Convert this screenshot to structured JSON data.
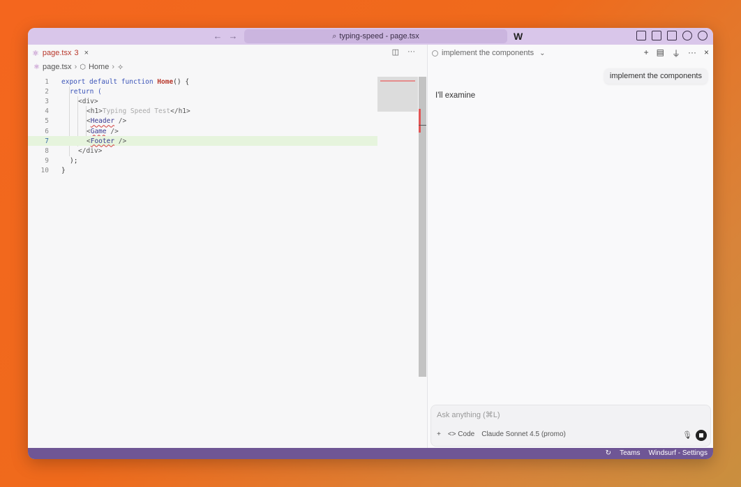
{
  "titlebar": {
    "back": "←",
    "forward": "→",
    "search_icon": "⌕",
    "title": "typing-speed - page.tsx",
    "logo": "W"
  },
  "editor": {
    "tab": {
      "icon": "⚛",
      "name": "page.tsx",
      "count": "3",
      "close": "×"
    },
    "tab_actions": {
      "split": "◫",
      "more": "···"
    },
    "breadcrumb": [
      "page.tsx",
      "Home"
    ],
    "line_numbers": [
      "1",
      "2",
      "3",
      "4",
      "5",
      "6",
      "7",
      "8",
      "9",
      "10"
    ],
    "code": {
      "l1_kw": "export default function ",
      "l1_fn": "Home",
      "l1_rest": "() {",
      "l2": "return (",
      "l3": "<div>",
      "l4_open": "<h1>",
      "l4_text": "Typing Speed Test",
      "l4_close": "</h1>",
      "l5_lt": "<",
      "l5_comp": "Header",
      "l5_end": " />",
      "l6_lt": "<",
      "l6_comp": "Game",
      "l6_end": " />",
      "l7_lt": "<",
      "l7_comp": "Footer",
      "l7_end": " />",
      "l8": "</div>",
      "l9": ");",
      "l10": "}"
    }
  },
  "chat": {
    "header_title": "implement the components",
    "user_message": "implement the components",
    "assistant_reply": "I'll examine",
    "composer": {
      "placeholder": "Ask anything (⌘L)",
      "add": "+",
      "mode": "<> Code",
      "model": "Claude Sonnet 4.5 (promo)"
    }
  },
  "statusbar": {
    "sync": "↻",
    "teams": "Teams",
    "settings": "Windsurf - Settings"
  },
  "colors": {
    "accent": "#6f5695",
    "titlebar": "#d9c6ea",
    "error": "#b8372b"
  }
}
